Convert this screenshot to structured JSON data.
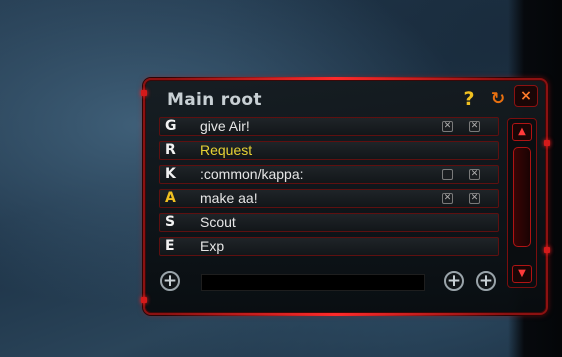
{
  "window": {
    "title": "Main root",
    "help_icon": "?",
    "refresh_icon": "↻",
    "close_icon": "×"
  },
  "rows": [
    {
      "key": "G",
      "key_color": "#f2f2f2",
      "label": "give Air!",
      "label_color": "#e6e6e6",
      "checkboxes": [
        true,
        true
      ]
    },
    {
      "key": "R",
      "key_color": "#f2f2f2",
      "label": "Request",
      "label_color": "#e8d234",
      "checkboxes": []
    },
    {
      "key": "K",
      "key_color": "#f2f2f2",
      "label": ":common/kappa:",
      "label_color": "#e6e6e6",
      "checkboxes": [
        false,
        true
      ]
    },
    {
      "key": "A",
      "key_color": "#f0c020",
      "label": "make aa!",
      "label_color": "#e6e6e6",
      "checkboxes": [
        true,
        true
      ]
    },
    {
      "key": "S",
      "key_color": "#f2f2f2",
      "label": "Scout",
      "label_color": "#e6e6e6",
      "checkboxes": []
    },
    {
      "key": "E",
      "key_color": "#f2f2f2",
      "label": "Exp",
      "label_color": "#e6e6e6",
      "checkboxes": []
    }
  ],
  "footer": {
    "add_left_icon": "+",
    "name_input_value": "",
    "add_right_1_icon": "+",
    "add_right_2_icon": "+"
  },
  "scrollbar": {
    "up_icon": "▲",
    "down_icon": "▼"
  },
  "colors": {
    "accent_red": "#d41a1a",
    "title": "#c8d0d4",
    "help": "#f0c020",
    "refresh": "#e87010"
  }
}
